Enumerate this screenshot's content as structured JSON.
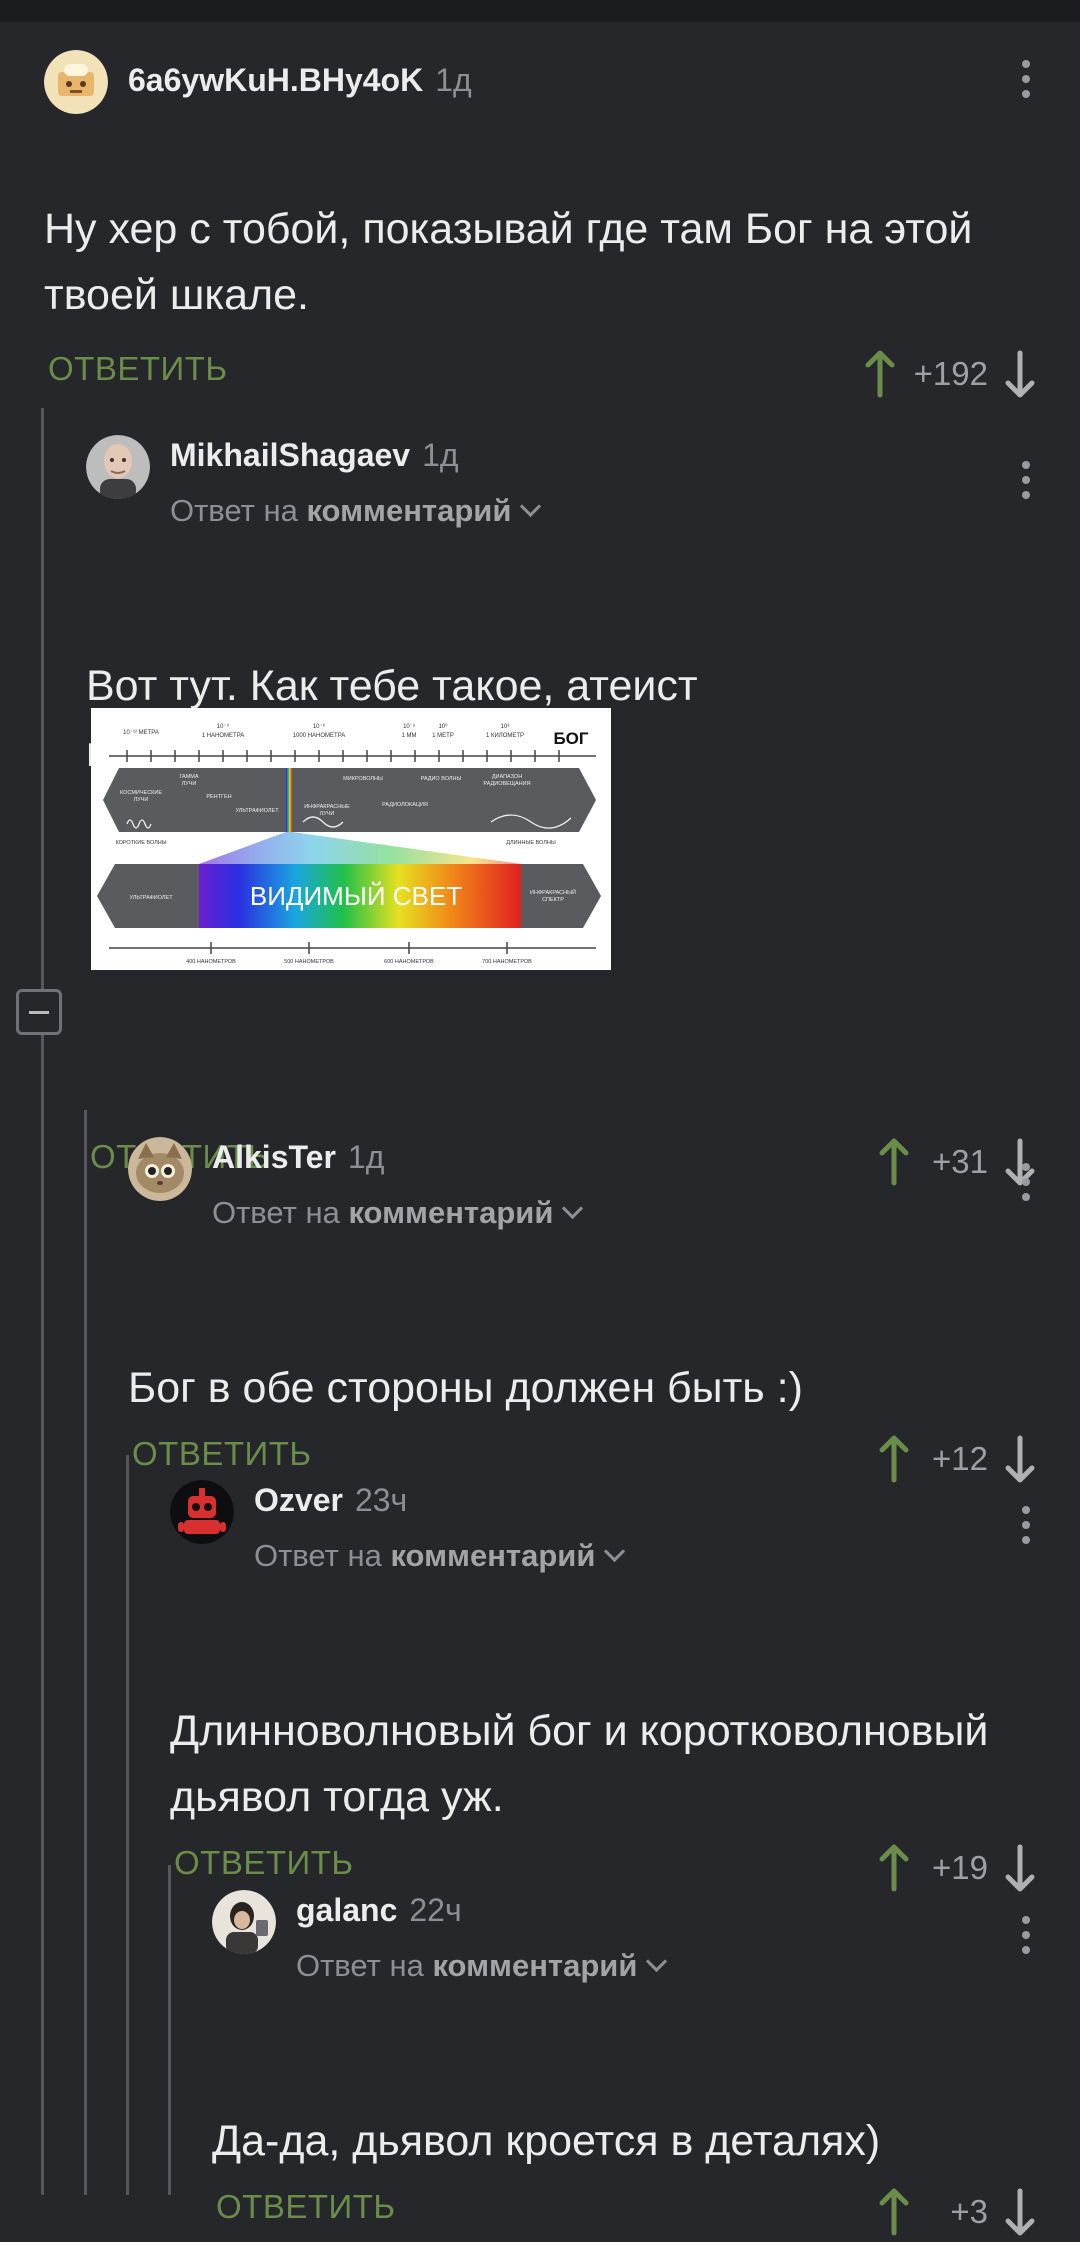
{
  "comments": [
    {
      "username": "6a6ywKuH.BHy4oK",
      "time": "1д",
      "text": "Ну хер с тобой, показывай где там Бог на этой твоей шкале.",
      "reply_label": "ОТВЕТИТЬ",
      "score": "+192"
    },
    {
      "username": "MikhailShagaev",
      "time": "1д",
      "reply_prefix": "Ответ на",
      "reply_target": "комментарий",
      "text": "Вот тут. Как тебе такое, атеист несчастный?!",
      "reply_label": "ОТВЕТИТЬ",
      "score": "+31",
      "image": {
        "god_label": "БОГ",
        "visible_light": "ВИДИМЫЙ СВЕТ",
        "top_scale": [
          "10⁻¹² МЕТРА",
          "10⁻⁹ 1 НАНОМЕТРА",
          "10⁻⁶ 1000 НАНОМЕТРА",
          "10⁻³ 1 ММ",
          "10⁰ 1 МЕТР",
          "10³ 1 КИЛОМЕТР"
        ],
        "bands": [
          "КОСМИЧЕСКИЕ ЛУЧИ",
          "ГАММА ЛУЧИ",
          "РЕНТГЕН",
          "УЛЬТРАФИОЛЕТ",
          "ИНФРАКРАСНЫЕ ЛУЧИ",
          "МИКРОВОЛНЫ",
          "РАДИОЛОКАЦИЯ",
          "РАДИО ВОЛНЫ",
          "ДИАПАЗОН РАДИОВЕЩАНИЯ"
        ],
        "short_waves": "КОРОТКИЕ ВОЛНЫ",
        "long_waves": "ДЛИННЫЕ ВОЛНЫ",
        "left_band": "УЛЬТРАФИОЛЕТ",
        "right_band": "ИНФРАКРАСНЫЙ СПЕКТР",
        "bottom_scale": [
          "400 НАНОМЕТРОВ",
          "500 НАНОМЕТРОВ",
          "600 НАНОМЕТРОВ",
          "700 НАНОМЕТРОВ"
        ]
      }
    },
    {
      "username": "AlkisTer",
      "time": "1д",
      "reply_prefix": "Ответ на",
      "reply_target": "комментарий",
      "text": "Бог в обе стороны должен быть :)",
      "reply_label": "ОТВЕТИТЬ",
      "score": "+12"
    },
    {
      "username": "Ozver",
      "time": "23ч",
      "reply_prefix": "Ответ на",
      "reply_target": "комментарий",
      "text": "Длинноволновый бог и коротковолновый дьявол тогда уж.",
      "reply_label": "ОТВЕТИТЬ",
      "score": "+19"
    },
    {
      "username": "galanc",
      "time": "22ч",
      "reply_prefix": "Ответ на",
      "reply_target": "комментарий",
      "text": "Да-да, дьявол кроется в деталях)",
      "reply_label": "ОТВЕТИТЬ",
      "score": "+3"
    }
  ],
  "colors": {
    "background": "#26272b",
    "reply_green": "#6a8d4a",
    "upvote_green": "#6a8d4a",
    "thread_line": "#55575d"
  },
  "icons": [
    "upvote-arrow-icon",
    "downvote-arrow-icon",
    "more-options-icon",
    "chevron-down-icon",
    "collapse-thread-icon"
  ]
}
